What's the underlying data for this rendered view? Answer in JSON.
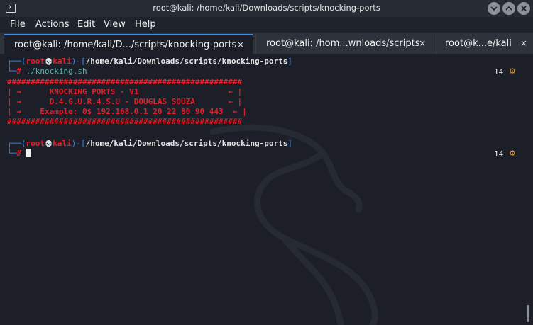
{
  "window": {
    "title": "root@kali: /home/kali/Downloads/scripts/knocking-ports",
    "app_icon": "terminal-icon",
    "controls": [
      "minimize-icon",
      "maximize-icon",
      "close-icon"
    ]
  },
  "menubar": {
    "items": [
      "File",
      "Actions",
      "Edit",
      "View",
      "Help"
    ]
  },
  "tabs": [
    {
      "label": "root@kali: /home/kali/D.../scripts/knocking-ports",
      "close": "×",
      "active": true
    },
    {
      "label": "root@kali: /hom...wnloads/scripts",
      "close": "×",
      "active": false
    },
    {
      "label": "root@k...e/kali",
      "close": "×",
      "active": false
    }
  ],
  "terminal": {
    "prompt1": {
      "corner_top": "┌──(",
      "user": "root",
      "skull": "💀",
      "host": "kali",
      "sep": ")-[",
      "path": "/home/kali/Downloads/scripts/knocking-ports",
      "close": "]",
      "corner_bottom": "└─",
      "hash": "#",
      "command": " ./knocking.sh",
      "right_num": "14",
      "right_icon": "gear-icon"
    },
    "banner": [
      "##################################################",
      "| →      KNOCKING PORTS - V1                   ← |",
      "| →      D.4.G.U.R.4.S.U - DOUGLAS SOUZA       ← |",
      "| →    Example: 0$ 192.168.0.1 20 22 80 90 443  ← |",
      "##################################################"
    ],
    "prompt2": {
      "corner_top": "┌──(",
      "user": "root",
      "skull": "💀",
      "host": "kali",
      "sep": ")-[",
      "path": "/home/kali/Downloads/scripts/knocking-ports",
      "close": "]",
      "corner_bottom": "└─",
      "hash": "#",
      "right_num": "14",
      "right_icon": "gear-icon"
    }
  },
  "colors": {
    "background": "#1c1f27",
    "prompt_blue": "#3c86e6",
    "prompt_red": "#e0202a",
    "command_teal": "#49b9b3",
    "banner_red": "#e0202a",
    "tab_accent": "#3d8ee6"
  }
}
